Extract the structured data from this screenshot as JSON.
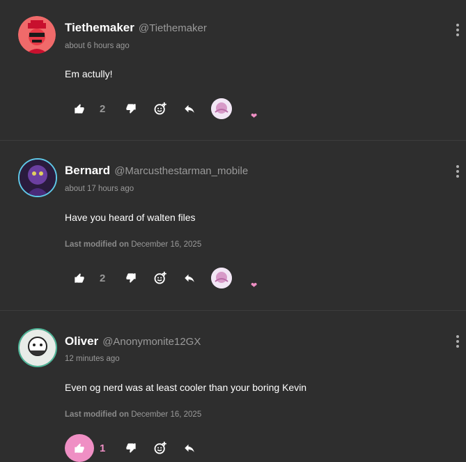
{
  "comments": [
    {
      "display_name": "Tiethemaker",
      "handle": "@Tiethemaker",
      "time": "about 6 hours ago",
      "body": "Em actully!",
      "modified_label": "",
      "modified_date": "",
      "like_count": "2",
      "liked": false,
      "reaction_icon": "heart"
    },
    {
      "display_name": "Bernard",
      "handle": "@Marcusthestarman_mobile",
      "time": "about 17 hours ago",
      "body": "Have you heard of walten files",
      "modified_label": "Last modified on",
      "modified_date": "December 16, 2025",
      "like_count": "2",
      "liked": false,
      "reaction_icon": "heart"
    },
    {
      "display_name": "Oliver",
      "handle": "@Anonymonite12GX",
      "time": "12 minutes ago",
      "body": "Even og nerd was at least cooler than your boring Kevin",
      "modified_label": "Last modified on",
      "modified_date": "December 16, 2025",
      "like_count": "1",
      "liked": true
    }
  ],
  "colors": {
    "background": "#2e2e2e",
    "accent_pink": "#ef8fc4",
    "muted_text": "#9a9a9a",
    "divider": "#3d3d3d"
  }
}
